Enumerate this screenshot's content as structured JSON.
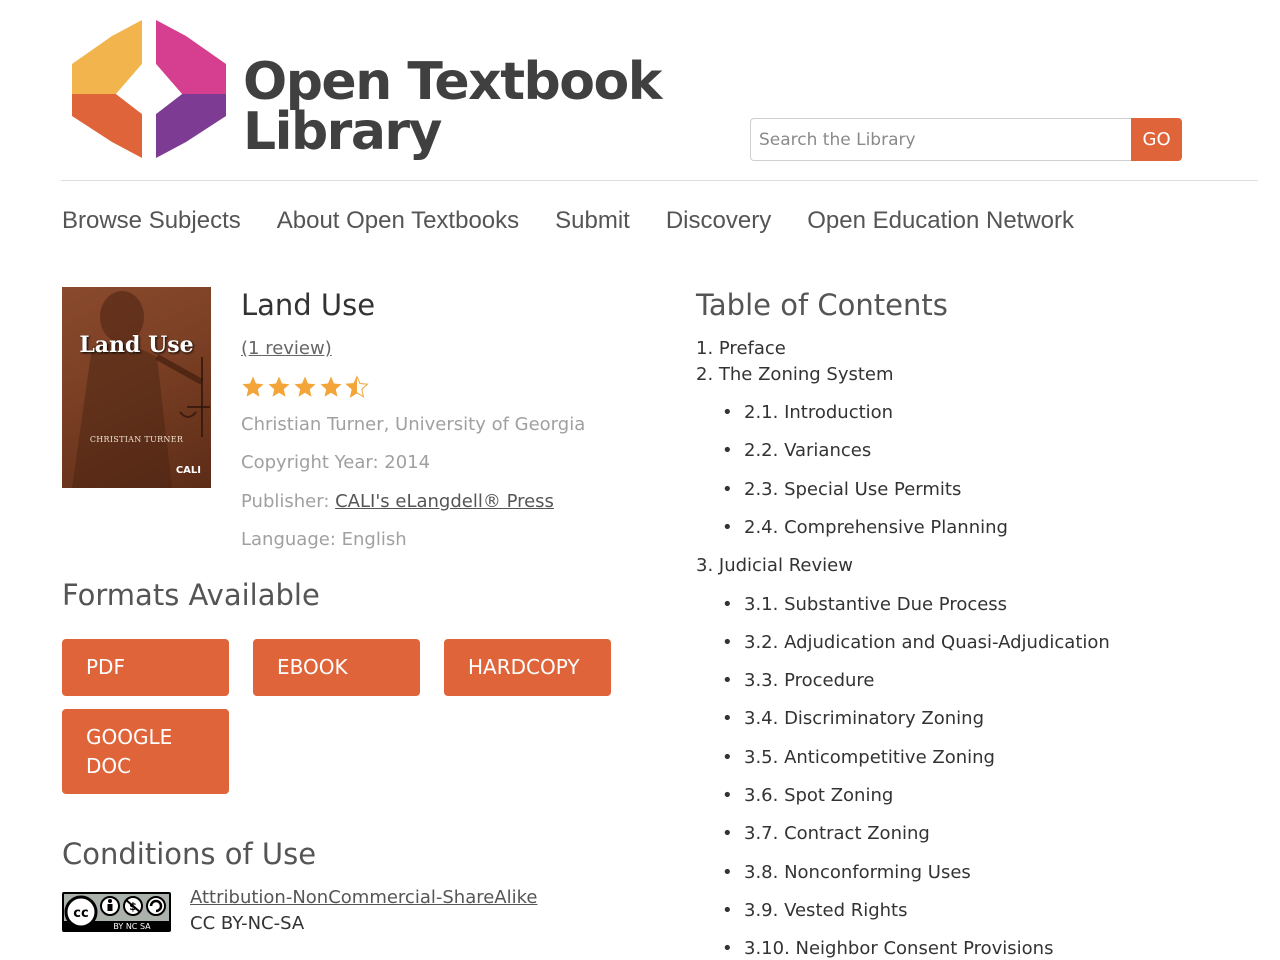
{
  "header": {
    "logo_line1": "Open Textbook",
    "logo_line2": "Library",
    "search_placeholder": "Search the Library",
    "search_button": "GO"
  },
  "nav": {
    "items": [
      "Browse Subjects",
      "About Open Textbooks",
      "Submit",
      "Discovery",
      "Open Education Network"
    ]
  },
  "book": {
    "cover_title": "Land Use",
    "cover_author": "CHRISTIAN TURNER",
    "cover_brand": "CALI",
    "title": "Land Use",
    "reviews": "(1 review)",
    "rating": 4.5,
    "rating_max": 5,
    "author": "Christian Turner, University of Georgia",
    "copyright": "Copyright Year: 2014",
    "publisher_label": "Publisher: ",
    "publisher": "CALI's eLangdell® Press",
    "language": "Language: English"
  },
  "formats": {
    "heading": "Formats Available",
    "buttons": [
      "PDF",
      "EBOOK",
      "HARDCOPY",
      "GOOGLE DOC"
    ]
  },
  "conditions": {
    "heading": "Conditions of Use",
    "license_name": "Attribution-NonCommercial-ShareAlike",
    "license_code": "CC BY-NC-SA",
    "badge_text": "BY NC SA"
  },
  "toc": {
    "heading": "Table of Contents",
    "items": [
      {
        "label": "1. Preface",
        "children": []
      },
      {
        "label": "2. The Zoning System",
        "children": [
          "2.1. Introduction",
          "2.2. Variances",
          "2.3. Special Use Permits",
          "2.4. Comprehensive Planning"
        ]
      },
      {
        "label": "3. Judicial Review",
        "children": [
          "3.1. Substantive Due Process",
          "3.2. Adjudication and Quasi-Adjudication",
          "3.3. Procedure",
          "3.4. Discriminatory Zoning",
          "3.5. Anticompetitive Zoning",
          "3.6. Spot Zoning",
          "3.7. Contract Zoning",
          "3.8. Nonconforming Uses",
          "3.9. Vested Rights",
          "3.10. Neighbor Consent Provisions"
        ]
      }
    ]
  },
  "colors": {
    "accent": "#e0643a",
    "star": "#f4a53a",
    "logo_yellow": "#f2b44d",
    "logo_orange": "#e0643a",
    "logo_magenta": "#d63f8f",
    "logo_purple": "#7d3b94"
  }
}
